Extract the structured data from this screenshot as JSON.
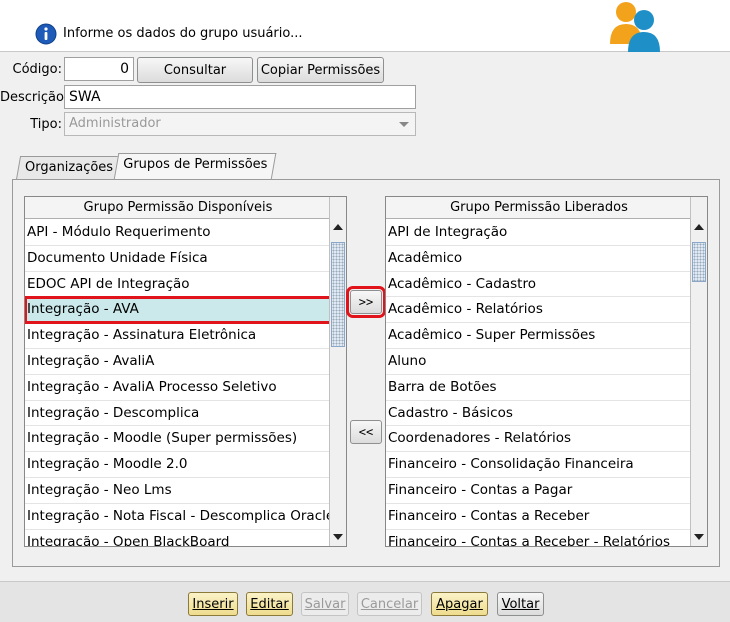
{
  "header": {
    "text": "Informe os dados do grupo usuário...",
    "info_icon": "info-icon",
    "users_icon": "users-icon"
  },
  "form": {
    "codigo_label": "Código:",
    "codigo_value": "0",
    "consultar_label": "Consultar",
    "copiar_label": "Copiar Permissões",
    "descricao_label": "Descrição:",
    "descricao_value": "SWA",
    "tipo_label": "Tipo:",
    "tipo_value": "Administrador"
  },
  "tabs": [
    {
      "label": "Organizações",
      "active": false
    },
    {
      "label": "Grupos de Permissões",
      "active": true
    }
  ],
  "available": {
    "header": "Grupo Permissão Disponíveis",
    "items": [
      "API - Módulo Requerimento",
      "Documento Unidade Física",
      "EDOC API de Integração",
      "Integração - AVA",
      "Integração - Assinatura Eletrônica",
      "Integração - AvaliA",
      "Integração - AvaliA Processo Seletivo",
      "Integração - Descomplica",
      "Integração - Moodle (Super permissões)",
      "Integração - Moodle 2.0",
      "Integração - Neo Lms",
      "Integração - Nota Fiscal - Descomplica Oracle",
      "Integração - Open BlackBoard"
    ],
    "selected_item": "Integração - AVA"
  },
  "granted": {
    "header": "Grupo Permissão Liberados",
    "items": [
      "API de Integração",
      "Acadêmico",
      "Acadêmico - Cadastro",
      "Acadêmico - Relatórios",
      "Acadêmico - Super Permissões",
      "Aluno",
      "Barra de Botões",
      "Cadastro - Básicos",
      "Coordenadores - Relatórios",
      "Financeiro - Consolidação Financeira",
      "Financeiro - Contas a Pagar",
      "Financeiro - Contas a Receber",
      "Financeiro - Contas a Receber - Relatórios"
    ]
  },
  "move": {
    "add_label": ">>",
    "remove_label": "<<"
  },
  "footer": {
    "buttons": [
      {
        "label": "Inserir",
        "state": "enabled"
      },
      {
        "label": "Editar",
        "state": "enabled"
      },
      {
        "label": "Salvar",
        "state": "disabled"
      },
      {
        "label": "Cancelar",
        "state": "disabled"
      },
      {
        "label": "Apagar",
        "state": "enabled"
      },
      {
        "label": "Voltar",
        "state": "plain"
      }
    ]
  },
  "colors": {
    "highlight": "#e0141a",
    "selected_row": "#cbe8ea",
    "enabled_button": "#eedc8e"
  }
}
